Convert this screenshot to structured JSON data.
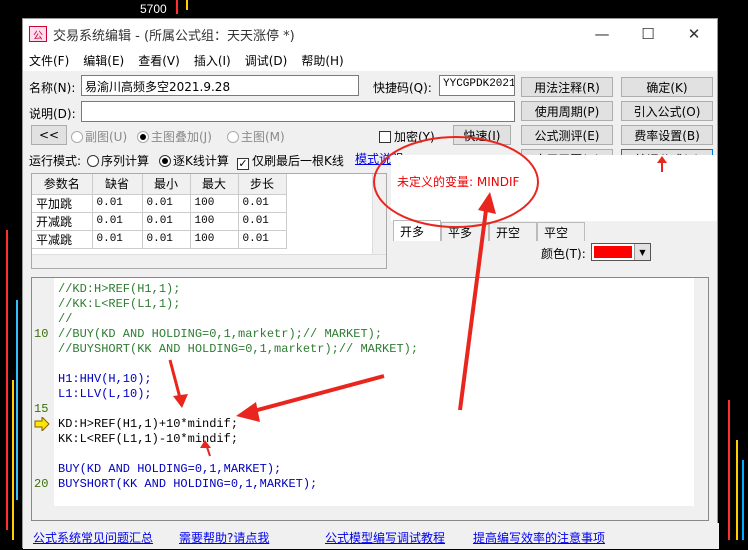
{
  "background": {
    "top_label": "5700"
  },
  "window": {
    "title": "交易系统编辑 - (所属公式组：天天涨停 *)",
    "controls": {
      "minimize": "—",
      "maximize": "☐",
      "close": "✕"
    }
  },
  "menu": [
    "文件(F)",
    "编辑(E)",
    "查看(V)",
    "插入(I)",
    "调试(D)",
    "帮助(H)"
  ],
  "form": {
    "name_label": "名称(N):",
    "name_value": "易渝川高频多空2021.9.28",
    "shortcut_label": "快捷码(Q):",
    "shortcut_value": "YYCGPDK2021",
    "desc_label": "说明(D):",
    "desc_value": ""
  },
  "buttons_right": {
    "usage_note": "用法注释(R)",
    "confirm": "确定(K)",
    "use_period": "使用周期(P)",
    "import_formula": "引入公式(O)",
    "test_formula": "公式测评(E)",
    "fee_settings": "费率设置(B)",
    "apply_chart": "应用于图(A)",
    "compile": "编译公式(F)"
  },
  "display_opts": {
    "collapse": "<<",
    "sub_chart": "副图(U)",
    "main_overlay": "主图叠加(J)",
    "main_chart": "主图(M)",
    "encrypt": "加密(Y)",
    "fast": "快速(I)"
  },
  "run_mode": {
    "label": "运行模式:",
    "sequence": "序列计算",
    "bar_by_bar": "逐K线计算",
    "last_only": "仅刷最后一根K线",
    "help_link": "模式说明"
  },
  "params": {
    "headers": [
      "参数名",
      "缺省",
      "最小",
      "最大",
      "步长"
    ],
    "rows": [
      [
        "平加跳",
        "0.01",
        "0.01",
        "100",
        "0.01"
      ],
      [
        "开减跳",
        "0.01",
        "0.01",
        "100",
        "0.01"
      ],
      [
        "平减跳",
        "0.01",
        "0.01",
        "100",
        "0.01"
      ]
    ]
  },
  "error": {
    "message": "未定义的变量: MINDIF"
  },
  "tabs": [
    "开多",
    "平多",
    "开空",
    "平空"
  ],
  "color": {
    "label": "颜色(T):",
    "value": "#ff0000"
  },
  "code": {
    "lines": [
      {
        "num": "",
        "text": "//KD:H>REF(H1,1);",
        "cls": "c-green"
      },
      {
        "num": "",
        "text": "//KK:L<REF(L1,1);",
        "cls": "c-green"
      },
      {
        "num": "",
        "text": "//",
        "cls": "c-green"
      },
      {
        "num": "10",
        "text": "//BUY(KD AND HOLDING=0,1,marketr);// MARKET);",
        "cls": "c-green"
      },
      {
        "num": "",
        "text": "//BUYSHORT(KK AND HOLDING=0,1,marketr);// MARKET);",
        "cls": "c-green"
      },
      {
        "num": "",
        "text": "",
        "cls": "c-black"
      },
      {
        "num": "",
        "text": "H1:HHV(H,10);",
        "cls": "c-navy"
      },
      {
        "num": "",
        "text": "L1:LLV(L,10);",
        "cls": "c-navy"
      },
      {
        "num": "15",
        "text": "",
        "cls": "c-black"
      },
      {
        "num": "",
        "text": "KD:H>REF(H1,1)+10*mindif;",
        "cls": "c-black"
      },
      {
        "num": "",
        "text": "KK:L<REF(L1,1)-10*mindif;",
        "cls": "c-black"
      },
      {
        "num": "",
        "text": "",
        "cls": "c-black"
      },
      {
        "num": "",
        "text": "BUY(KD AND HOLDING=0,1,MARKET);",
        "cls": "c-navy"
      },
      {
        "num": "20",
        "text": "BUYSHORT(KK AND HOLDING=0,1,MARKET);",
        "cls": "c-navy"
      }
    ]
  },
  "footer_links": [
    "公式系统常见问题汇总",
    "需要帮助?请点我",
    "公式模型编写调试教程",
    "提高编写效率的注意事项"
  ],
  "annotation_color": "#e8261e"
}
